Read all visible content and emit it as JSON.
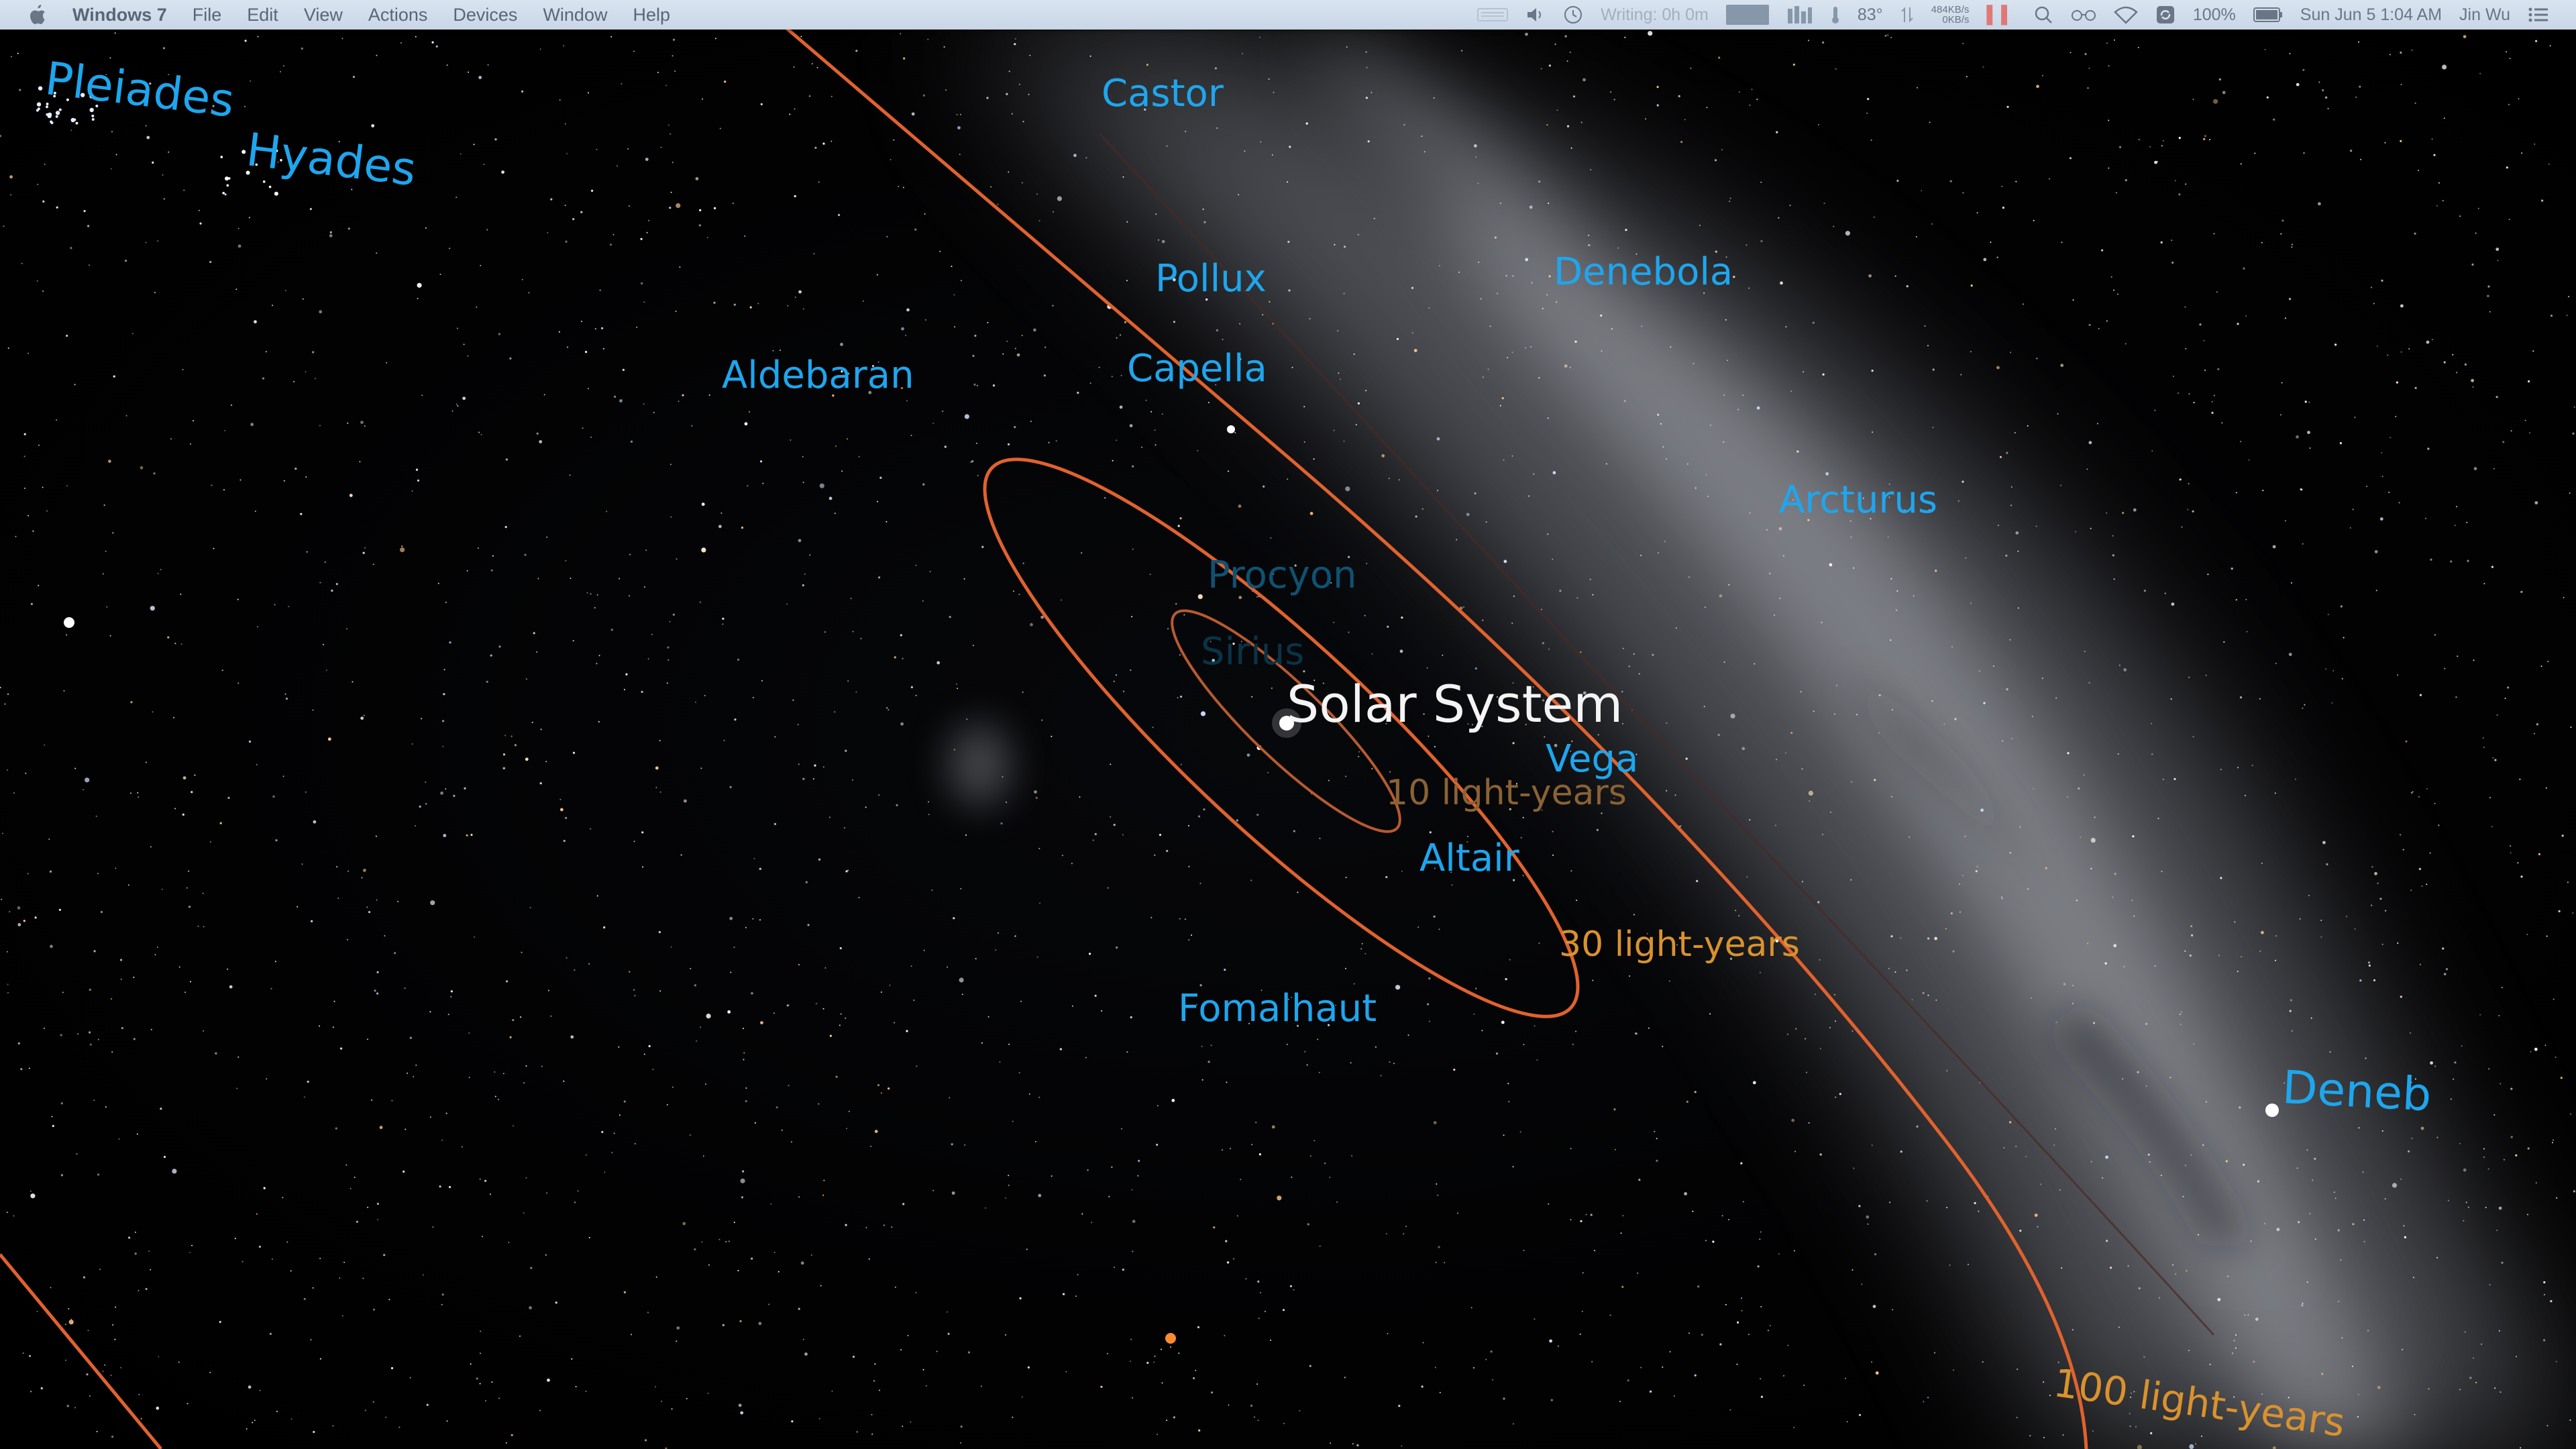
{
  "menubar": {
    "apple_icon": "apple-logo-icon",
    "app_name": "Windows 7",
    "menus": [
      "File",
      "Edit",
      "View",
      "Actions",
      "Devices",
      "Window",
      "Help"
    ],
    "status": {
      "writing": "Writing: 0h 0m",
      "temperature": "83°",
      "network_up": "484KB/s",
      "network_down": "0KB/s",
      "battery": "100%",
      "datetime": "Sun Jun 5  1:04 AM",
      "user": "Jin Wu"
    }
  },
  "sky": {
    "center_label": "Solar System",
    "stars": {
      "pleiades": "Pleiades",
      "hyades": "Hyades",
      "castor": "Castor",
      "pollux": "Pollux",
      "denebola": "Denebola",
      "aldebaran": "Aldebaran",
      "capella": "Capella",
      "arcturus": "Arcturus",
      "procyon": "Procyon",
      "sirius": "Sirius",
      "vega": "Vega",
      "altair": "Altair",
      "fomalhaut": "Fomalhaut",
      "deneb": "Deneb"
    },
    "distance_rings": {
      "ring_10": "10 light-years",
      "ring_30": "30 light-years",
      "ring_100": "100 light-years"
    },
    "colors": {
      "star_label": "#1ea6ee",
      "ring": "#e0622e",
      "ring_label": "#d9922e",
      "center_label": "#f4f4f4"
    }
  }
}
